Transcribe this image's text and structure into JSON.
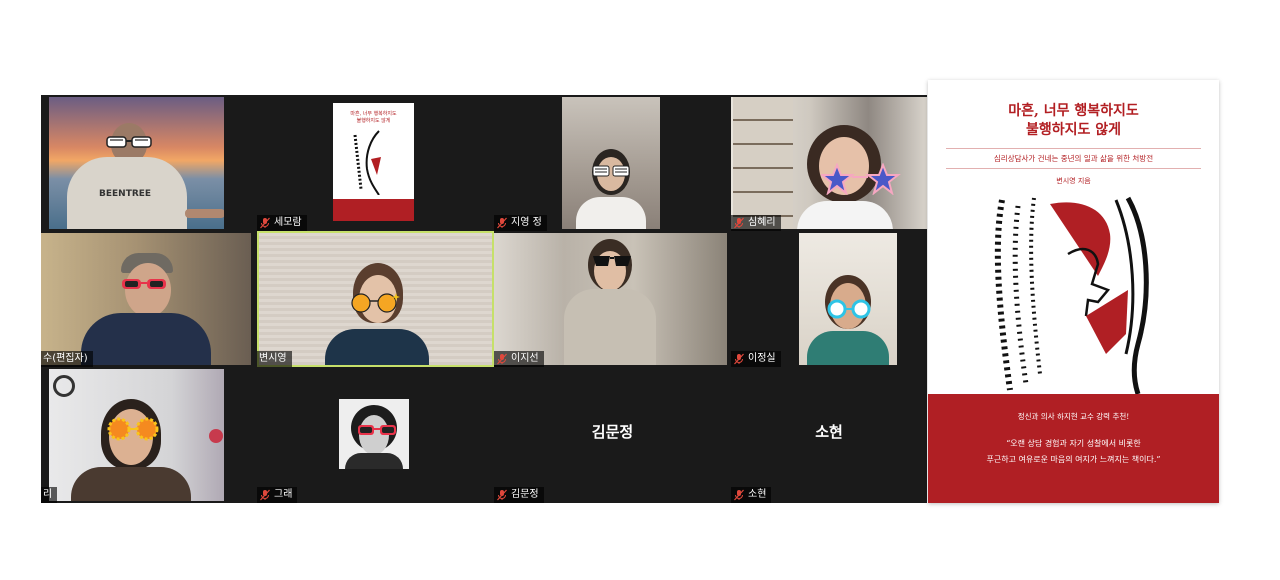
{
  "participants": [
    {
      "id": "p1",
      "name": "",
      "shirt_text": "BEENTREE"
    },
    {
      "id": "p2",
      "name": "세모람"
    },
    {
      "id": "p3",
      "name": "지영 정"
    },
    {
      "id": "p4",
      "name": "심혜리"
    },
    {
      "id": "p5",
      "name": "수(편집자)"
    },
    {
      "id": "p6",
      "name": "변시영"
    },
    {
      "id": "p7",
      "name": "이지선"
    },
    {
      "id": "p8",
      "name": "이정실"
    },
    {
      "id": "p9",
      "name": "리"
    },
    {
      "id": "p10",
      "name": "그래"
    },
    {
      "id": "p11",
      "name": "김문정",
      "center_name": "김문정"
    },
    {
      "id": "p12",
      "name": "소현",
      "center_name": "소현"
    }
  ],
  "book": {
    "title_line1": "마흔, 너무 행복하지도",
    "title_line2": "불행하지도 않게",
    "subtitle": "심리상담사가 건네는 중년의 일과 삶을 위한 처방전",
    "author": "변시영 지음",
    "recommend": "정신과 의사 하지현 교수 강력 추천!",
    "quote_line1": "“오랜 상담 경험과 자기 성찰에서 비롯한",
    "quote_line2": "푸근하고 여유로운 마음의 여지가 느껴지는 책이다.”"
  },
  "colors": {
    "accent_red": "#b01f24",
    "active_speaker_border": "#c6e06a",
    "grid_bg": "#1a1a1a",
    "muted_icon": "#e0483c"
  },
  "icons": {
    "muted": "microphone-muted-icon"
  }
}
